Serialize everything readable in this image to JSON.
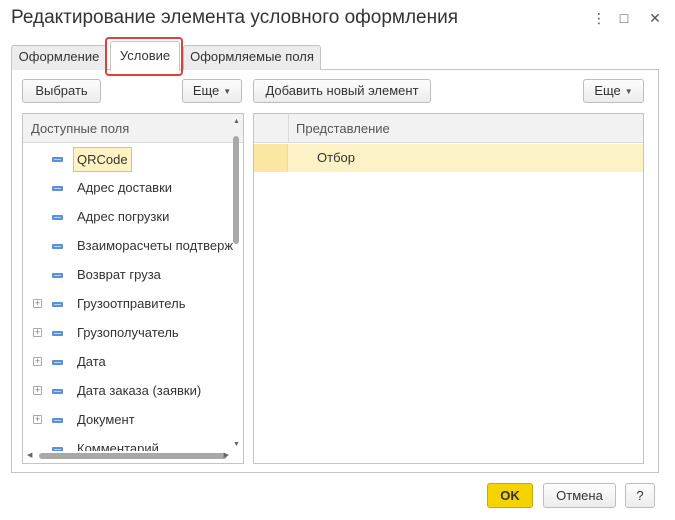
{
  "window": {
    "title": "Редактирование элемента условного оформления",
    "more_glyph": "⋮",
    "minimize_glyph": "□",
    "close_glyph": "✕"
  },
  "tabs": [
    {
      "label": "Оформление"
    },
    {
      "label": "Условие",
      "active": true
    },
    {
      "label": "Оформляемые поля"
    }
  ],
  "left_toolbar": {
    "select_label": "Выбрать",
    "more_label": "Еще"
  },
  "right_toolbar": {
    "add_label": "Добавить новый элемент",
    "more_label": "Еще"
  },
  "available_fields": {
    "header": "Доступные поля",
    "items": [
      {
        "label": "QRCode",
        "expandable": false,
        "selected": true
      },
      {
        "label": "Адрес доставки",
        "expandable": false
      },
      {
        "label": "Адрес погрузки",
        "expandable": false
      },
      {
        "label": "Взаиморасчеты подтверж",
        "expandable": false
      },
      {
        "label": "Возврат груза",
        "expandable": false
      },
      {
        "label": "Грузоотправитель",
        "expandable": true
      },
      {
        "label": "Грузополучатель",
        "expandable": true
      },
      {
        "label": "Дата",
        "expandable": true
      },
      {
        "label": "Дата заказа (заявки)",
        "expandable": true
      },
      {
        "label": "Документ",
        "expandable": true
      },
      {
        "label": "Комментарий",
        "expandable": false
      }
    ]
  },
  "conditions_table": {
    "header": "Представление",
    "rows": [
      {
        "label": "Отбор"
      }
    ]
  },
  "footer": {
    "ok_label": "OK",
    "cancel_label": "Отмена",
    "help_label": "?"
  },
  "colors": {
    "accent_ok": "#f5d300",
    "selection_fill": "#fdf2c5",
    "tab_highlight": "#d9433c",
    "field_icon": "#5b8fd6"
  },
  "icons": {
    "expander": "plus-square-icon",
    "field": "field-icon",
    "dropdown": "triangle-down-icon"
  }
}
